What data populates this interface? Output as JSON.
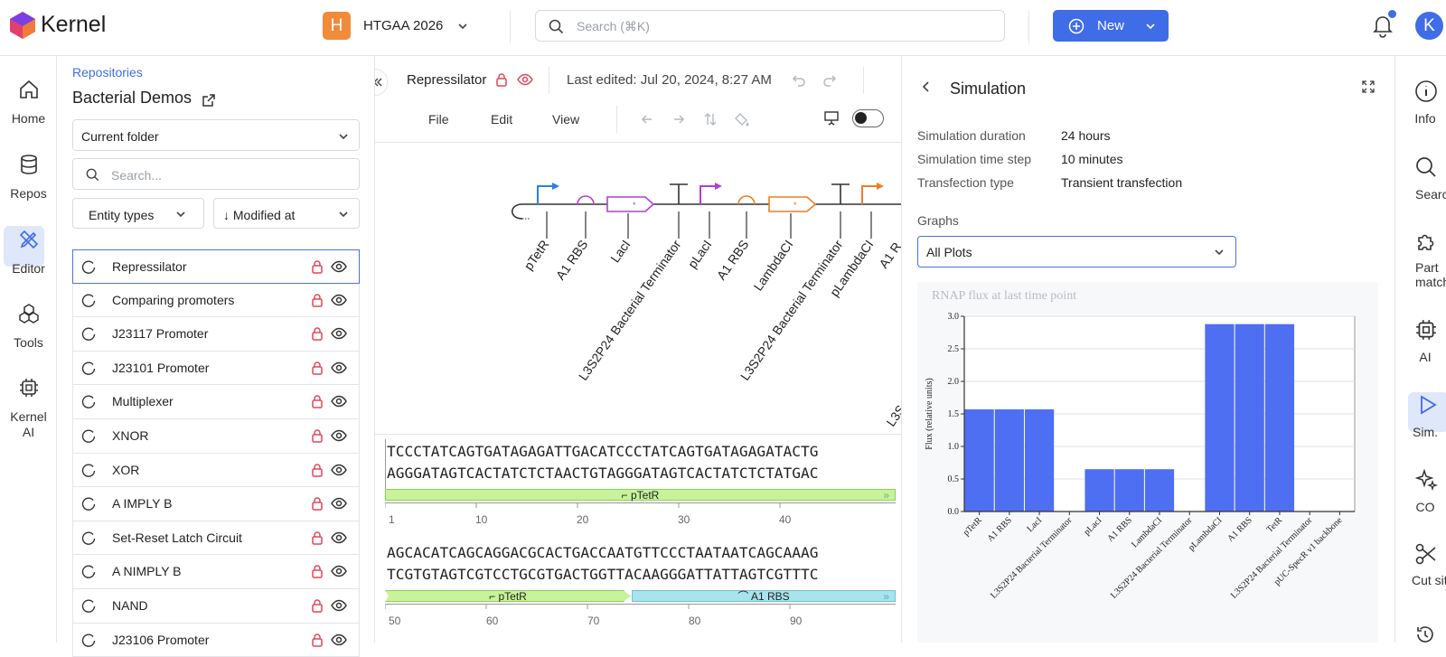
{
  "app": {
    "name": "Kernel",
    "brand_color": "#3f6de8"
  },
  "workspace": {
    "badge": "H",
    "name": "HTGAA 2026",
    "badge_color": "#f08b3a"
  },
  "search": {
    "placeholder": "Search (⌘K)"
  },
  "new_button": {
    "label": "New"
  },
  "user": {
    "initial": "K"
  },
  "left_nav": [
    {
      "label": "Home",
      "icon": "home-icon"
    },
    {
      "label": "Repos",
      "icon": "database-icon"
    },
    {
      "label": "Editor",
      "icon": "pencil-ruler-icon",
      "active": true
    },
    {
      "label": "Tools",
      "icon": "cubes-icon"
    },
    {
      "label": "Kernel",
      "label2": "AI",
      "icon": "chip-icon"
    }
  ],
  "panel": {
    "breadcrumb": "Repositories",
    "title": "Bacterial Demos",
    "folder_select": "Current folder",
    "search_placeholder": "Search...",
    "filter_types": "Entity types",
    "sort": "↓ Modified at",
    "items": [
      "Repressilator",
      "Comparing promoters",
      "J23117 Promoter",
      "J23101 Promoter",
      "Multiplexer",
      "XNOR",
      "XOR",
      "A IMPLY B",
      "Set-Reset Latch Circuit",
      "A NIMPLY B",
      "NAND",
      "J23106 Promoter"
    ]
  },
  "editor": {
    "name": "Repressilator",
    "last_edited": "Last edited: Jul 20, 2024, 8:27 AM",
    "menus": [
      "File",
      "Edit",
      "View"
    ],
    "parts": [
      "pTetR",
      "A1 RBS",
      "LacI",
      "L3S2P24 Bacterial Terminator",
      "pLacI",
      "A1 RBS",
      "LambdaCI",
      "L3S2P24 Bacterial Terminator",
      "pLambdaCI",
      "A1 R",
      "L3S"
    ],
    "seq1_top": "TCCCTATCAGTGATAGAGATTGACATCCCTATCAGTGATAGAGATACTG",
    "seq1_bottom": "AGGGATAGTCACTATCTCTAACTGTAGGGATAGTCACTATCTCTATGAC",
    "seq1_ticks": [
      "1",
      "10",
      "20",
      "30",
      "40"
    ],
    "seq1_feature": "pTetR",
    "seq2_top": "AGCACATCAGCAGGACGCACTGACCAATGTTCCCTAATAATCAGCAAAG",
    "seq2_bottom": "TCGTGTAGTCGTCCTGCGTGACTGGTTACAAGGGATTATTAGTCGTTTC",
    "seq2_ticks": [
      "50",
      "60",
      "70",
      "80",
      "90"
    ],
    "seq2_feature_a": "pTetR",
    "seq2_feature_b": "A1 RBS",
    "colors": {
      "promoter_blue": "#2f7de1",
      "purple": "#b23ed6",
      "orange": "#ee7d24",
      "green_feature": "#c8f39a",
      "cyan_feature": "#a8e3ee"
    }
  },
  "simulation": {
    "title": "Simulation",
    "fields": [
      {
        "key": "Simulation duration",
        "value": "24 hours"
      },
      {
        "key": "Simulation time step",
        "value": "10 minutes"
      },
      {
        "key": "Transfection type",
        "value": "Transient transfection"
      }
    ],
    "graphs_label": "Graphs",
    "graphs_select": "All Plots"
  },
  "chart_data": {
    "type": "bar",
    "title": "RNAP flux at last time point",
    "xlabel": "",
    "ylabel": "Flux (relative units)",
    "ylim": [
      0,
      3.0
    ],
    "yticks": [
      0.0,
      0.5,
      1.0,
      1.5,
      2.0,
      2.5,
      3.0
    ],
    "categories": [
      "pTetR",
      "A1 RBS",
      "LacI",
      "L3S2P24 Bacterial Terminator",
      "pLacI",
      "A1 RBS",
      "LambdaCI",
      "L3S2P24 Bacterial Terminator",
      "pLambdaCI",
      "A1 RBS",
      "TetR",
      "L3S2P24 Bacterial Terminator",
      "pUC-SpecR v1 backbone"
    ],
    "values": [
      1.57,
      1.57,
      1.57,
      0,
      0.65,
      0.65,
      0.65,
      0,
      2.88,
      2.88,
      2.88,
      0,
      0
    ],
    "bar_color": "#4f6ff2",
    "grid": true
  },
  "right_nav": [
    {
      "label": "Info",
      "icon": "info-icon"
    },
    {
      "label": "Search",
      "icon": "search-icon"
    },
    {
      "label": "Part",
      "label2": "match",
      "icon": "puzzle-icon"
    },
    {
      "label": "AI",
      "icon": "chip-icon"
    },
    {
      "label": "Sim.",
      "icon": "play-icon",
      "active": true
    },
    {
      "label": "CO",
      "icon": "sparkle-icon"
    },
    {
      "label": "Cut site",
      "icon": "scissors-icon"
    }
  ]
}
